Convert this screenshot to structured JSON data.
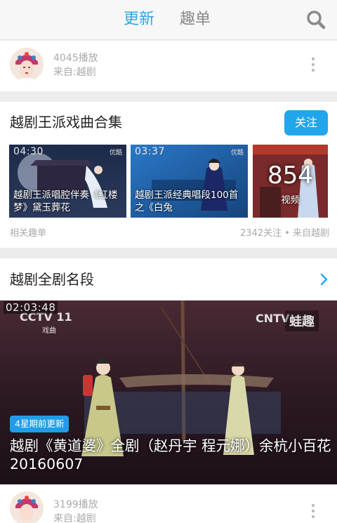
{
  "header": {
    "tabs": [
      {
        "label": "更新",
        "active": true
      },
      {
        "label": "趣单",
        "active": false
      }
    ],
    "search_icon": "search-icon",
    "accent_color": "#29a8e8"
  },
  "feed": [
    {
      "plays": "4045播放",
      "source": "来自:越剧"
    },
    {
      "plays": "3199播放",
      "source": "来自:越剧"
    }
  ],
  "playlist": {
    "title": "越剧王派戏曲合集",
    "follow_label": "关注",
    "thumbnails": [
      {
        "duration": "04:30",
        "caption": "越剧王派唱腔伴奏《红楼梦》黛玉葬花",
        "logo": "优酷"
      },
      {
        "duration": "03:37",
        "caption": "越剧王派经典唱段100首之《白兔",
        "logo": "优酷"
      }
    ],
    "count": {
      "number": "854",
      "label": "视频"
    },
    "footer_left": "相关趣单",
    "footer_right": "2342关注 • 来自越剧"
  },
  "album": {
    "title": "越剧全剧名段",
    "video": {
      "duration": "02:03:48",
      "badge": "4星期前更新",
      "title": "越剧《黄道婆》全剧（赵丹宇 程元娜）余杭小百花20160607",
      "channel_logo": "CCTV 11",
      "channel_sub": "戏曲",
      "watermark": "CNTV",
      "corner_mark": "蛙趣"
    }
  }
}
